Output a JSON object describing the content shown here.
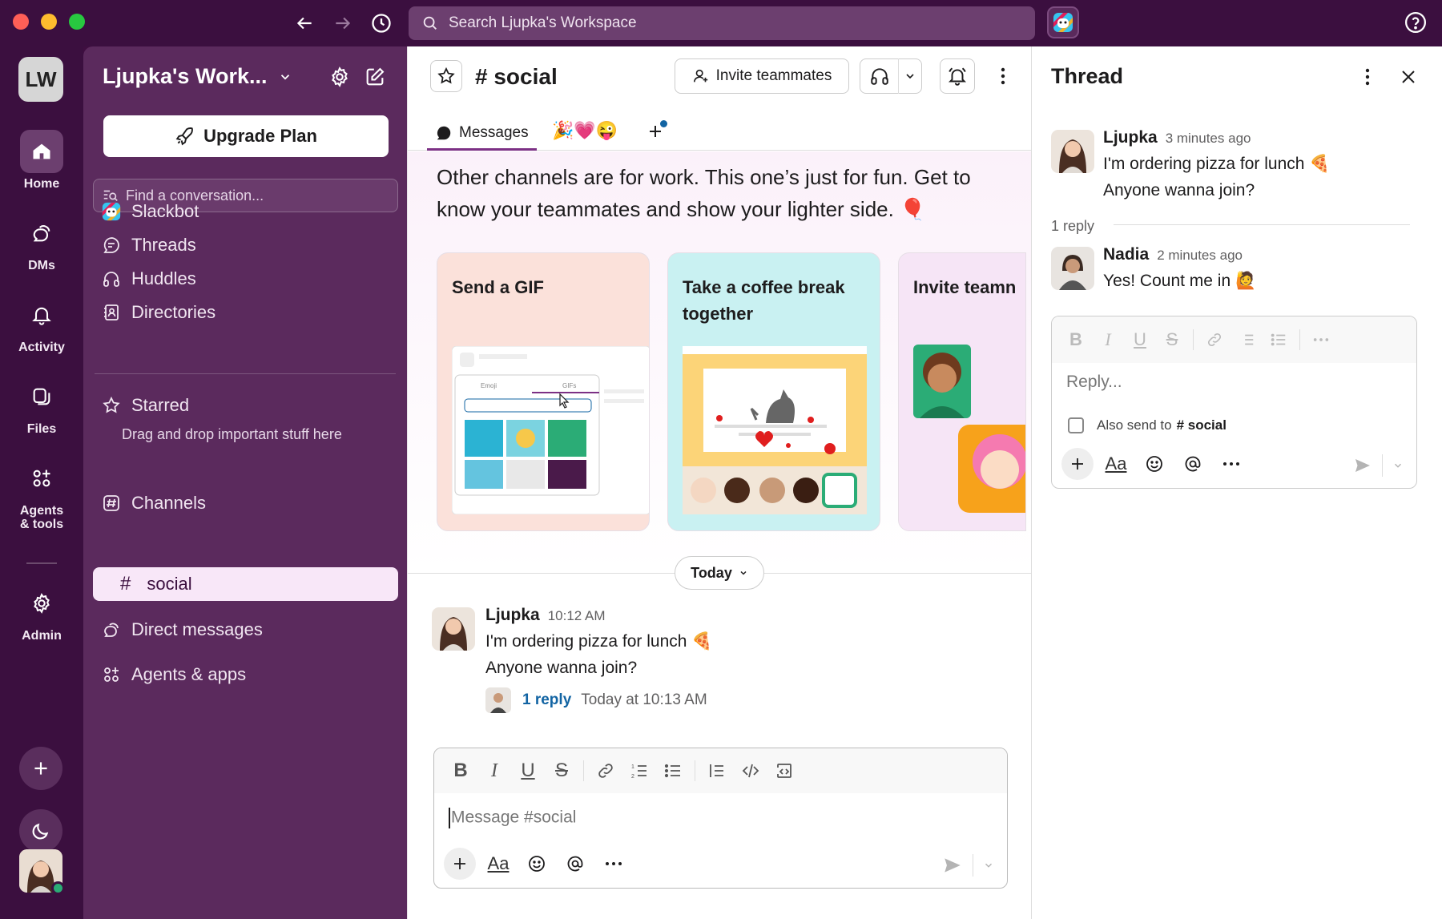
{
  "search": {
    "placeholder": "Search Ljupka's Workspace"
  },
  "rail": {
    "workspace_initials": "LW",
    "items": [
      {
        "label": "Home"
      },
      {
        "label": "DMs"
      },
      {
        "label": "Activity"
      },
      {
        "label": "Files"
      },
      {
        "label": "Agents\n& tools"
      },
      {
        "label": "Admin"
      }
    ]
  },
  "sidebar": {
    "workspace_name": "Ljupka's Work...",
    "upgrade_label": "Upgrade Plan",
    "find_placeholder": "Find a conversation...",
    "items": [
      {
        "label": "Slackbot"
      },
      {
        "label": "Threads"
      },
      {
        "label": "Huddles"
      },
      {
        "label": "Directories"
      }
    ],
    "starred_label": "Starred",
    "starred_hint": "Drag and drop important stuff here",
    "channels_label": "Channels",
    "active_channel": "social",
    "direct_messages_label": "Direct messages",
    "agents_label": "Agents & apps"
  },
  "channel": {
    "name": "# social",
    "invite_label": "Invite teammates",
    "tab_messages": "Messages",
    "tab_emoji": "🎉💗😜",
    "intro_text": "Other channels are for work. This one’s just for fun. Get to know your teammates and show your lighter side. 🎈",
    "cards": [
      {
        "title": "Send a GIF"
      },
      {
        "title": "Take a coffee break together"
      },
      {
        "title": "Invite teamn"
      }
    ],
    "today_label": "Today",
    "message": {
      "author": "Ljupka",
      "time": "10:12 AM",
      "line1": "I'm ordering pizza for lunch 🍕",
      "line2": "Anyone wanna join?",
      "reply_link": "1 reply",
      "reply_time": "Today at 10:13 AM"
    },
    "composer_placeholder": "Message #social"
  },
  "thread": {
    "title": "Thread",
    "parent": {
      "author": "Ljupka",
      "time": "3 minutes ago",
      "line1": "I'm ordering pizza for lunch 🍕",
      "line2": "Anyone wanna join?"
    },
    "reply_count": "1 reply",
    "reply": {
      "author": "Nadia",
      "time": "2 minutes ago",
      "line1": "Yes! Count me in 🙋"
    },
    "composer_placeholder": "Reply...",
    "also_send_label": "Also send to",
    "also_send_channel": "# social"
  },
  "colors": {
    "aubergine": "#3b0f3f",
    "sidebar": "#5b2a5d",
    "link": "#1264a3",
    "presence": "#2bac76"
  }
}
